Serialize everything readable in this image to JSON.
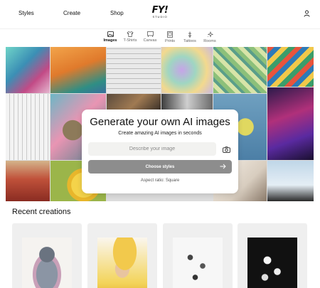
{
  "nav": {
    "styles": "Styles",
    "create": "Create",
    "shop": "Shop",
    "logo_main": "FY!",
    "logo_sub": "STUDIO"
  },
  "tabs": [
    {
      "label": "Images",
      "icon": "image-icon",
      "active": true
    },
    {
      "label": "T-Shirts",
      "icon": "tshirt-icon",
      "active": false
    },
    {
      "label": "Canvas",
      "icon": "canvas-icon",
      "active": false
    },
    {
      "label": "Prints",
      "icon": "print-icon",
      "active": false
    },
    {
      "label": "Tattoos",
      "icon": "tattoo-icon",
      "active": false
    },
    {
      "label": "Rooms",
      "icon": "sparkle-icon",
      "active": false
    }
  ],
  "generator": {
    "title": "Generate your own AI images",
    "subtitle": "Create amazing AI images in seconds",
    "input_placeholder": "Describe your image",
    "button_label": "Choose styles",
    "aspect": "Aspect ratio: Square"
  },
  "recent": {
    "title": "Recent creations"
  },
  "colors": {
    "button_disabled": "#8d8d8d",
    "card_bg": "#efefef",
    "input_bg": "#f2f2f0"
  }
}
